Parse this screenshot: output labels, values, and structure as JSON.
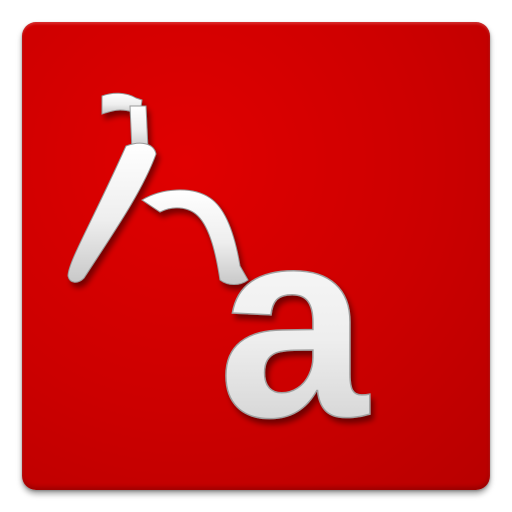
{
  "icon": {
    "glyph_ethiopic": "ኧ",
    "glyph_latin": "a",
    "background_color": "#cc0000",
    "glyph_color": "#f2f2f2"
  }
}
